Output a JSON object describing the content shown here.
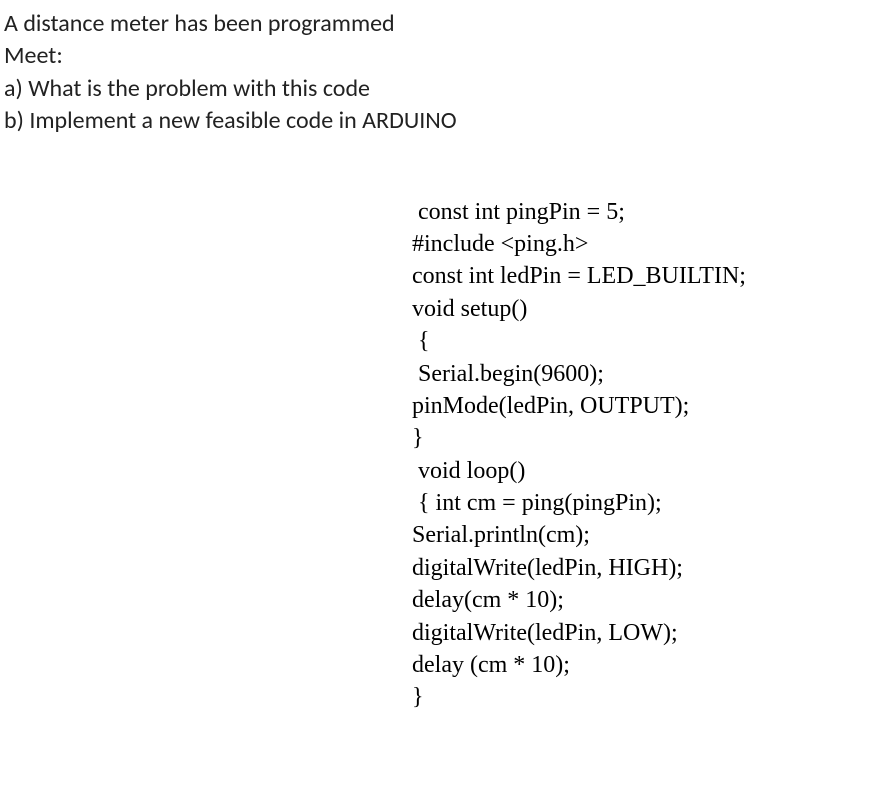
{
  "question": {
    "line1": "A distance meter has been programmed",
    "line2": "Meet:",
    "line3": "a) What is the problem with this code",
    "line4": "b) Implement a new feasible code in ARDUINO"
  },
  "code": {
    "l1": " const int pingPin = 5;",
    "l2": "#include <ping.h>",
    "l3": "const int ledPin = LED_BUILTIN;",
    "l4": "void setup()",
    "l5": " {",
    "l6": " Serial.begin(9600);",
    "l7": "pinMode(ledPin, OUTPUT);",
    "l8": "}",
    "l9": " void loop()",
    "l10": " { int cm = ping(pingPin);",
    "l11": "Serial.println(cm);",
    "l12": "digitalWrite(ledPin, HIGH);",
    "l13": "delay(cm * 10);",
    "l14": "digitalWrite(ledPin, LOW);",
    "l15": "delay (cm * 10);",
    "l16": "}"
  }
}
